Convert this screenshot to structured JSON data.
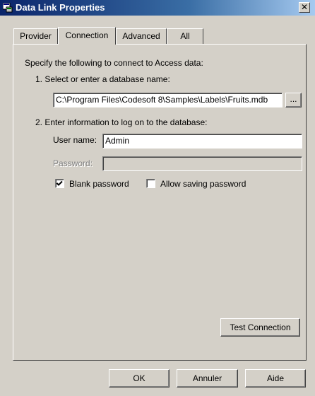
{
  "window": {
    "title": "Data Link Properties",
    "close_glyph": "✕"
  },
  "tabs": [
    {
      "label": "Provider",
      "active": false
    },
    {
      "label": "Connection",
      "active": true
    },
    {
      "label": "Advanced",
      "active": false
    },
    {
      "label": "All",
      "active": false
    }
  ],
  "connection": {
    "intro": "Specify the following to connect to Access data:",
    "step1_label": "1. Select or enter a database name:",
    "database_path": "C:\\Program Files\\Codesoft 8\\Samples\\Labels\\Fruits.mdb",
    "browse_label": "...",
    "step2_label": "2. Enter information to log on to the database:",
    "username_label": "User name:",
    "username_value": "Admin",
    "password_label": "Password:",
    "password_value": "",
    "blank_password_label": "Blank password",
    "blank_password_checked": true,
    "allow_saving_label": "Allow saving password",
    "allow_saving_checked": false,
    "test_connection_label": "Test Connection"
  },
  "footer": {
    "ok_label": "OK",
    "cancel_label": "Annuler",
    "help_label": "Aide"
  }
}
